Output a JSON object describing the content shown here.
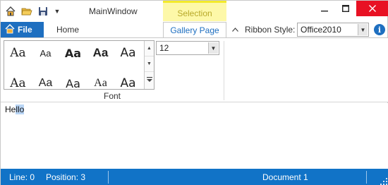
{
  "window": {
    "title": "MainWindow",
    "contextual_tab_group": "Selection",
    "quick_access": [
      "home-icon",
      "open-folder-icon",
      "save-icon"
    ],
    "controls": [
      "minimize-icon",
      "maximize-icon",
      "close-icon"
    ]
  },
  "ribbon": {
    "file_tab": "File",
    "tabs": [
      "Home",
      "Gallery Page"
    ],
    "active_tab": "Gallery Page",
    "style_label": "Ribbon Style:",
    "style_value": "Office2010",
    "font_group": {
      "label": "Font",
      "gallery_sample": "Aa",
      "size_value": "12"
    }
  },
  "editor": {
    "text_before": "He",
    "text_selected": "llo"
  },
  "status": {
    "line": "Line: 0",
    "position": "Position: 3",
    "document": "Document 1"
  },
  "colors": {
    "accent": "#1e6fc0",
    "status_bar": "#1173c7",
    "contextual": "#fdf8a8",
    "close": "#e81123"
  }
}
